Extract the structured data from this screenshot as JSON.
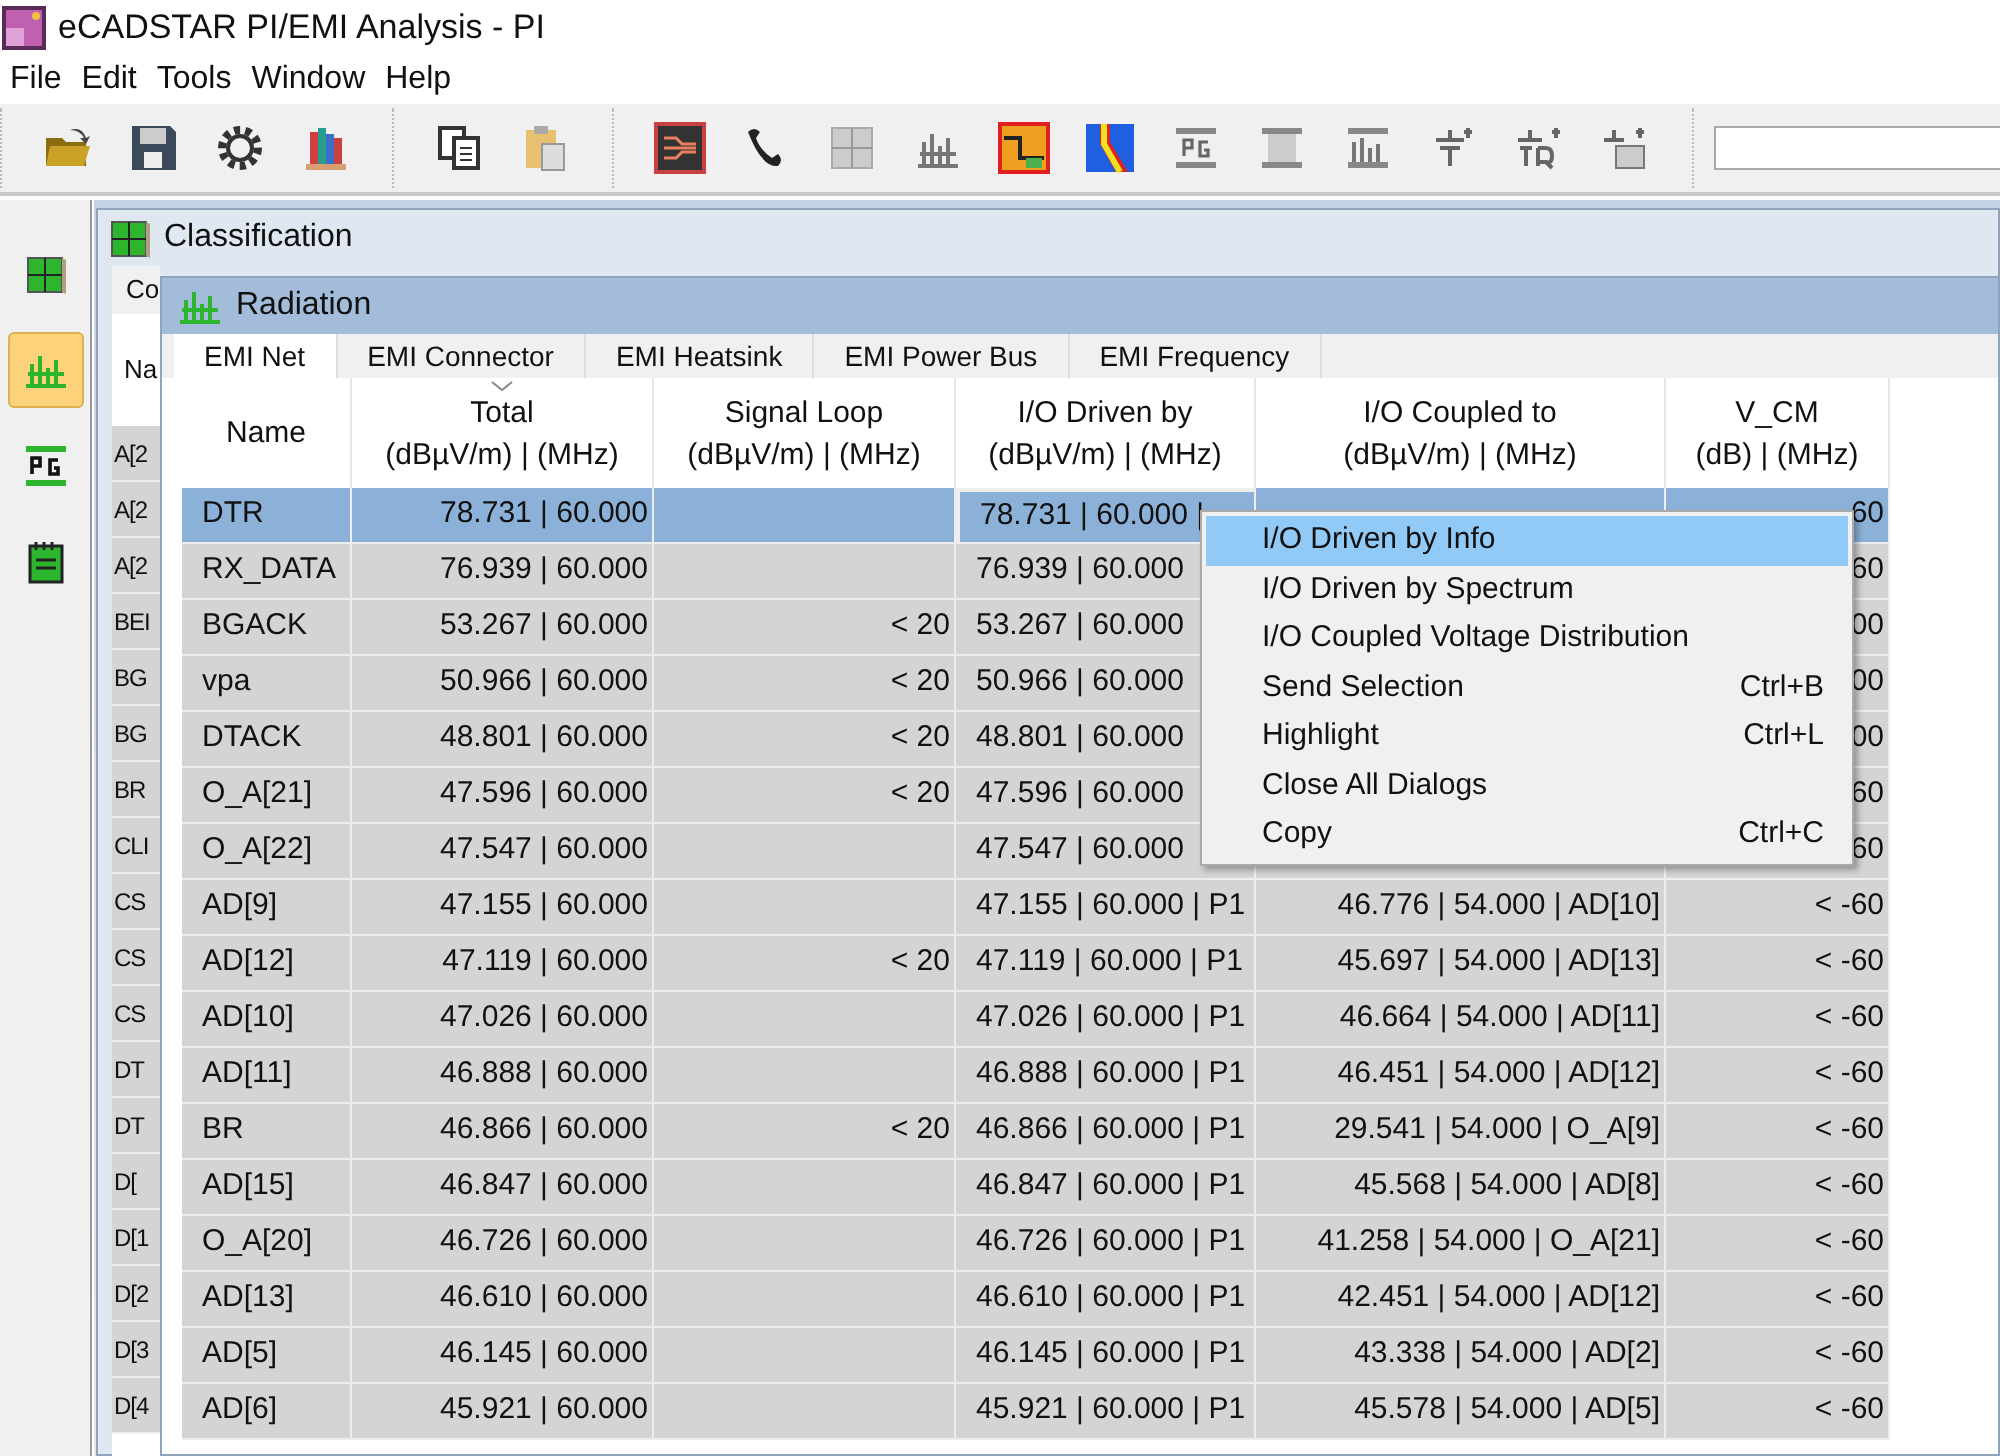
{
  "window": {
    "title": "eCADSTAR PI/EMI Analysis - PI"
  },
  "menu_bar": [
    "File",
    "Edit",
    "Tools",
    "Window",
    "Help"
  ],
  "sidebar": {
    "items": [
      {
        "selected": false
      },
      {
        "selected": true
      },
      {
        "selected": false
      },
      {
        "selected": false
      }
    ]
  },
  "classification": {
    "title": "Classification",
    "tab": "Co",
    "column": "Na",
    "rows": [
      "A[2",
      "A[2",
      "A[2",
      "BEI",
      "BG",
      "BG",
      "BR",
      "CLI",
      "CS",
      "CS",
      "CS",
      "DT",
      "DT",
      "D[",
      "D[1",
      "D[2",
      "D[3",
      "D[4"
    ]
  },
  "radiation": {
    "title": "Radiation",
    "tabs": [
      {
        "label": "EMI Net",
        "selected": true
      },
      {
        "label": "EMI Connector",
        "selected": false
      },
      {
        "label": "EMI Heatsink",
        "selected": false
      },
      {
        "label": "EMI Power Bus",
        "selected": false
      },
      {
        "label": "EMI Frequency",
        "selected": false
      }
    ],
    "columns": [
      {
        "title": "Name",
        "sorted": false
      },
      {
        "title": "Total",
        "unit": "(dBµV/m) | (MHz)",
        "sorted": true
      },
      {
        "title": "Signal Loop",
        "unit": "(dBµV/m) | (MHz)",
        "sorted": false
      },
      {
        "title": "I/O Driven by",
        "unit": "(dBµV/m) | (MHz)",
        "sorted": false
      },
      {
        "title": "I/O Coupled to",
        "unit": "(dBµV/m) | (MHz)",
        "sorted": false
      },
      {
        "title": "V_CM",
        "unit": "(dB) | (MHz)",
        "sorted": false
      }
    ],
    "rows": [
      {
        "name": "DTR",
        "total": "78.731 | 60.000",
        "io_driven": "78.731 | 60.000 |",
        "v_cm": "60",
        "selected": true,
        "focused": true
      },
      {
        "name": "RX_DATA",
        "total": "76.939 | 60.000",
        "io_driven": "76.939 | 60.000",
        "v_cm": "60",
        "selected": false,
        "focused": false
      },
      {
        "name": "BGACK",
        "total": "53.267 | 60.000",
        "signal_loop": "< 20",
        "io_driven": "53.267 | 60.000",
        "v_cm": "00",
        "selected": false,
        "focused": false
      },
      {
        "name": "vpa",
        "total": "50.966 | 60.000",
        "signal_loop": "< 20",
        "io_driven": "50.966 | 60.000",
        "v_cm": "00",
        "selected": false,
        "focused": false
      },
      {
        "name": "DTACK",
        "total": "48.801 | 60.000",
        "signal_loop": "< 20",
        "io_driven": "48.801 | 60.000",
        "v_cm": "00",
        "selected": false,
        "focused": false
      },
      {
        "name": "O_A[21]",
        "total": "47.596 | 60.000",
        "signal_loop": "< 20",
        "io_driven": "47.596 | 60.000",
        "v_cm": "60",
        "selected": false,
        "focused": false
      },
      {
        "name": "O_A[22]",
        "total": "47.547 | 60.000",
        "io_driven": "47.547 | 60.000",
        "v_cm": "60",
        "selected": false,
        "focused": false
      },
      {
        "name": "AD[9]",
        "total": "47.155 | 60.000",
        "io_driven": "47.155 | 60.000 | P1",
        "io_coupled": "46.776 | 54.000 | AD[10]",
        "v_cm": "< -60",
        "selected": false,
        "focused": false
      },
      {
        "name": "AD[12]",
        "total": "47.119 | 60.000",
        "signal_loop": "< 20",
        "io_driven": "47.119 | 60.000 | P1",
        "io_coupled": "45.697 | 54.000 | AD[13]",
        "v_cm": "< -60",
        "selected": false,
        "focused": false
      },
      {
        "name": "AD[10]",
        "total": "47.026 | 60.000",
        "io_driven": "47.026 | 60.000 | P1",
        "io_coupled": "46.664 | 54.000 | AD[11]",
        "v_cm": "< -60",
        "selected": false,
        "focused": false
      },
      {
        "name": "AD[11]",
        "total": "46.888 | 60.000",
        "io_driven": "46.888 | 60.000 | P1",
        "io_coupled": "46.451 | 54.000 | AD[12]",
        "v_cm": "< -60",
        "selected": false,
        "focused": false
      },
      {
        "name": "BR",
        "total": "46.866 | 60.000",
        "signal_loop": "< 20",
        "io_driven": "46.866 | 60.000 | P1",
        "io_coupled": "29.541 | 54.000 | O_A[9]",
        "v_cm": "< -60",
        "selected": false,
        "focused": false
      },
      {
        "name": "AD[15]",
        "total": "46.847 | 60.000",
        "io_driven": "46.847 | 60.000 | P1",
        "io_coupled": "45.568 | 54.000 | AD[8]",
        "v_cm": "< -60",
        "selected": false,
        "focused": false
      },
      {
        "name": "O_A[20]",
        "total": "46.726 | 60.000",
        "io_driven": "46.726 | 60.000 | P1",
        "io_coupled": "41.258 | 54.000 | O_A[21]",
        "v_cm": "< -60",
        "selected": false,
        "focused": false
      },
      {
        "name": "AD[13]",
        "total": "46.610 | 60.000",
        "io_driven": "46.610 | 60.000 | P1",
        "io_coupled": "42.451 | 54.000 | AD[12]",
        "v_cm": "< -60",
        "selected": false,
        "focused": false
      },
      {
        "name": "AD[5]",
        "total": "46.145 | 60.000",
        "io_driven": "46.145 | 60.000 | P1",
        "io_coupled": "43.338 | 54.000 | AD[2]",
        "v_cm": "< -60",
        "selected": false,
        "focused": false
      },
      {
        "name": "AD[6]",
        "total": "45.921 | 60.000",
        "io_driven": "45.921 | 60.000 | P1",
        "io_coupled": "45.578 | 54.000 | AD[5]",
        "v_cm": "< -60",
        "selected": false,
        "focused": false
      }
    ]
  },
  "context_menu": {
    "items": [
      {
        "label": "I/O Driven by Info",
        "selected": true
      },
      {
        "label": "I/O Driven by Spectrum",
        "selected": false
      },
      {
        "label": "I/O Coupled Voltage Distribution",
        "selected": false
      },
      {
        "label": "Send Selection",
        "shortcut": "Ctrl+B",
        "selected": false
      },
      {
        "label": "Highlight",
        "shortcut": "Ctrl+L",
        "selected": false
      },
      {
        "label": "Close All Dialogs",
        "selected": false
      },
      {
        "label": "Copy",
        "shortcut": "Ctrl+C",
        "selected": false
      }
    ]
  }
}
